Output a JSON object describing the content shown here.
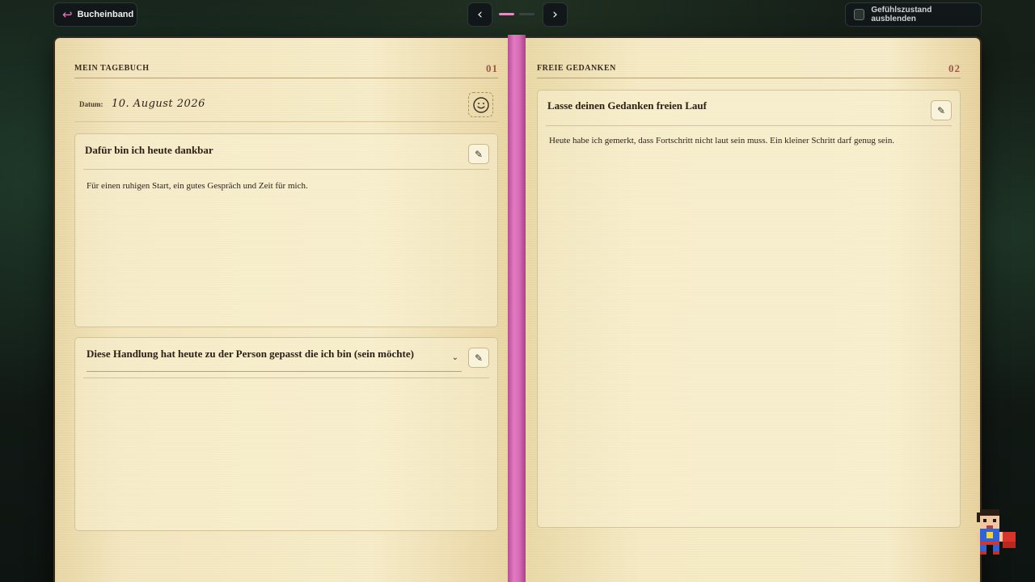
{
  "topbar": {
    "back_label": "Bucheinband",
    "mood_toggle_label": "Gefühlszustand ausblenden",
    "mood_toggle_checked": false,
    "pager_dots": 2,
    "pager_active_dot": 1
  },
  "left_page": {
    "title": "MEIN TAGEBUCH",
    "number": "01",
    "date_label": "Datum:",
    "date_value": "10. August 2026",
    "gratitude": {
      "title": "Dafür bin ich heute dankbar",
      "body": "Für einen ruhigen Start, ein gutes Gespräch und Zeit für mich."
    },
    "action": {
      "selected": "Diese Handlung hat heute zu der Person gepasst die ich bin (sein möchte)",
      "body": ""
    }
  },
  "right_page": {
    "title": "FREIE GEDANKEN",
    "number": "02",
    "free": {
      "title": "Lasse deinen Gedanken freien Lauf",
      "body": "Heute habe ich gemerkt, dass Fortschritt nicht laut sein muss. Ein kleiner Schritt darf genug sein."
    }
  },
  "colors": {
    "ribbon": "#d86ab4",
    "page_number": "#a0574c",
    "accent": "#e77ab8"
  },
  "icons": {
    "back": "return-arrow-icon",
    "prev": "chevron-left-icon",
    "next": "chevron-right-icon",
    "mood": "smiley-icon",
    "edit": "pencil-icon",
    "dropdown": "chevron-down-icon",
    "mascot": "pixel-superhero-icon"
  }
}
